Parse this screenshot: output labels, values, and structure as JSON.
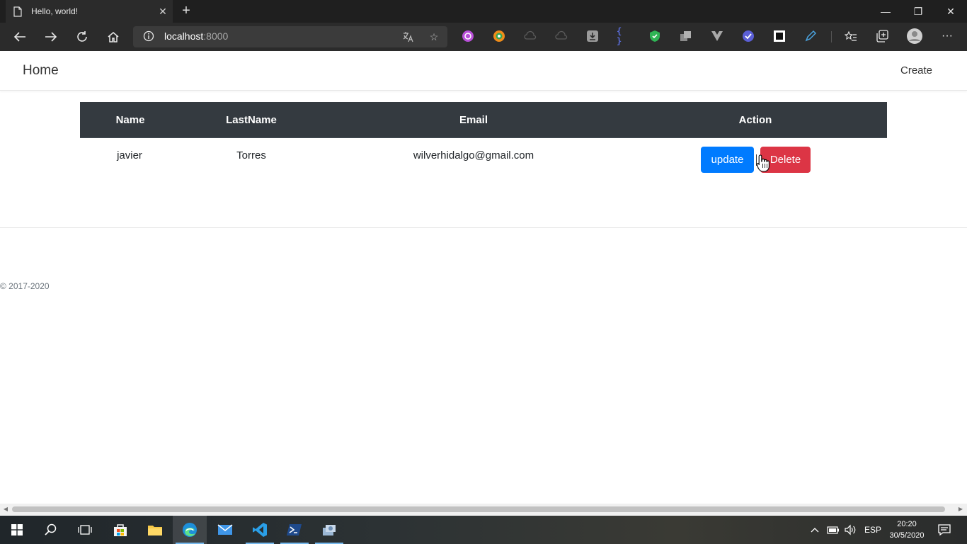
{
  "browser": {
    "tab_title": "Hello, world!",
    "address_host": "localhost",
    "address_port": ":8000"
  },
  "navbar": {
    "brand": "Home",
    "create_link": "Create"
  },
  "table": {
    "headers": [
      "Name",
      "LastName",
      "Email",
      "Action"
    ],
    "rows": [
      {
        "name": "javier",
        "lastname": "Torres",
        "email": "wilverhidalgo@gmail.com"
      }
    ],
    "update_label": "update",
    "delete_label": "Delete"
  },
  "footer": {
    "copyright": "© 2017-2020"
  },
  "taskbar": {
    "language": "ESP",
    "time": "20:20",
    "date": "30/5/2020"
  },
  "colors": {
    "table_header_bg": "#343a40",
    "update_button": "#007bff",
    "delete_button": "#dc3545"
  }
}
